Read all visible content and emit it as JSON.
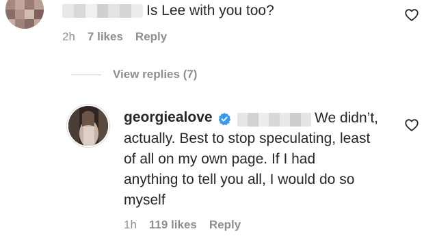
{
  "first_comment": {
    "text": "Is Lee with you too?",
    "time": "2h",
    "likes": "7 likes",
    "reply_label": "Reply"
  },
  "view_replies": {
    "label": "View replies (7)"
  },
  "reply_comment": {
    "username": "georgiealove",
    "verified": true,
    "text_lines": [
      "We didn’t,",
      "actually. Best to stop speculating, least",
      "of all on my own page. If I had",
      "anything to tell you all, I would do so",
      "myself"
    ],
    "time": "1h",
    "likes": "119 likes",
    "reply_label": "Reply"
  },
  "icons": {
    "like": "heart-icon",
    "verified": "verified-badge-icon"
  },
  "colors": {
    "text": "#262626",
    "secondary": "#8e8e8e",
    "verified_blue": "#3897f0",
    "divider": "#c7c7c7"
  }
}
